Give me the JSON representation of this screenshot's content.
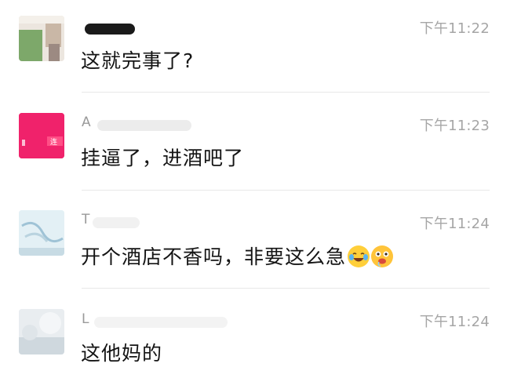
{
  "comments": [
    {
      "name": "",
      "time": "下午11:22",
      "text": "这就完事了?",
      "avatar_icon": "avatar-photo-icon"
    },
    {
      "name": "A",
      "time": "下午11:23",
      "text": "挂逼了，进酒吧了",
      "avatar_icon": "avatar-pink-icon",
      "avatar_overlay_text": "连"
    },
    {
      "name": "T",
      "time": "下午11:24",
      "text": "开个酒店不香吗，非要这么急",
      "avatar_icon": "avatar-sky-icon",
      "emojis": [
        "crying-laughing-emoji-icon",
        "drooling-face-emoji-icon"
      ]
    },
    {
      "name": "L",
      "time": "下午11:24",
      "text": "这他妈的",
      "avatar_icon": "avatar-blurred-icon"
    }
  ],
  "colors": {
    "time": "#a6a6a6",
    "name": "#9a9a9a",
    "text": "#141414",
    "divider": "#e8e8e8",
    "pink_avatar": "#f0226b"
  }
}
